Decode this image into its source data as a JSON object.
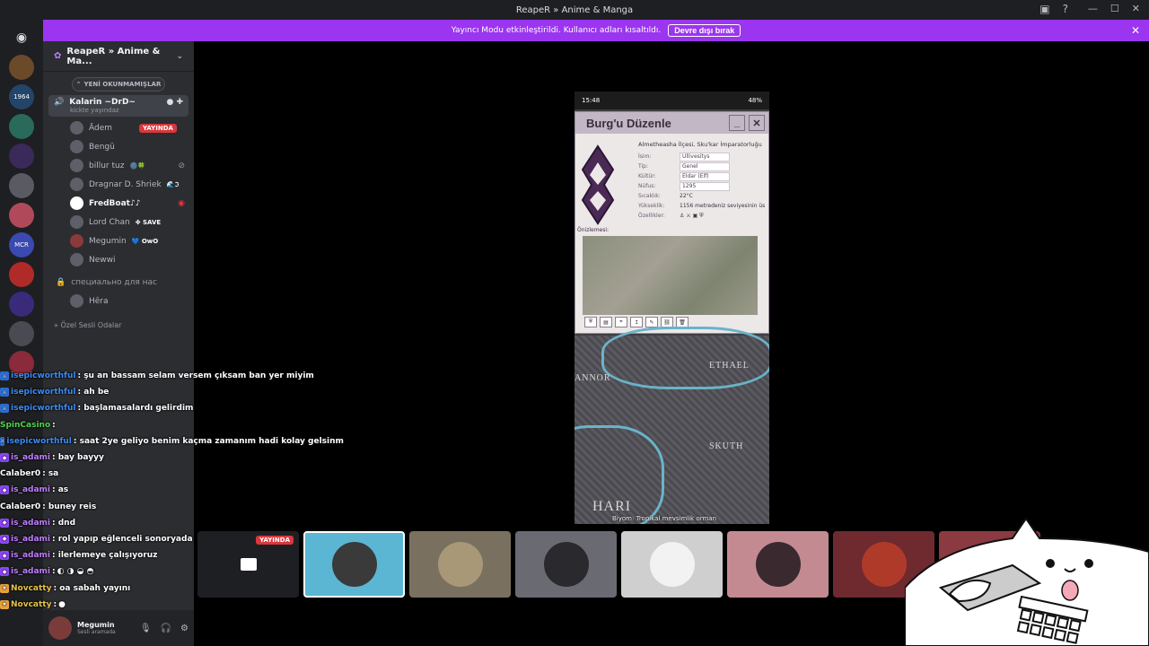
{
  "window": {
    "title": "ReapeR » Anime & Manga"
  },
  "banner": {
    "message": "Yayıncı Modu etkinleştirildi. Kullanıcı adları kısaltıldı.",
    "button": "Devre dışı bırak"
  },
  "rail": {
    "items": [
      "",
      "1964",
      "",
      "",
      "",
      "",
      "MCR",
      "",
      "",
      "",
      ""
    ]
  },
  "server": {
    "name": "ReapeR » Anime & Ma...",
    "new_unreads": "YENİ OKUNMAMIŞLAR"
  },
  "voice_channel": {
    "name": "Kalarin ~DrD~",
    "sub": "kickte yayındaz"
  },
  "members": [
    {
      "name": "Ädem",
      "live": "YAYINDA"
    },
    {
      "name": "Bengü"
    },
    {
      "name": "billur tuz",
      "tag": "🌚🍀"
    },
    {
      "name": "Dragnar D. Shriek",
      "tag": "🌊ℑ"
    },
    {
      "name": "FredBoat♪♪"
    },
    {
      "name": "Lord Chan",
      "tag": "✤ SAVE"
    },
    {
      "name": "Megumin",
      "tag": "💙 OwO"
    },
    {
      "name": "Newwi"
    }
  ],
  "private_channel": {
    "name": "специально для нас",
    "member": "Hêra"
  },
  "category": {
    "label": "» Özel Sesli Odalar"
  },
  "user_panel": {
    "name": "Megumin",
    "status": "Sesli aramada"
  },
  "phone": {
    "time": "15:48",
    "battery": "48%",
    "dialog_title": "Burg'u Düzenle",
    "burg_header": "Almetheasha İlçesi, Sku'kar İmparatorluğu",
    "fields": [
      {
        "key": "İsim:",
        "value": "Ullivesitys"
      },
      {
        "key": "Tip:",
        "value": "Genel"
      },
      {
        "key": "Kültür:",
        "value": "Eldar (Elf)"
      },
      {
        "key": "Nüfus:",
        "value": "1295"
      },
      {
        "key": "Sıcaklık:",
        "value": "22°C"
      },
      {
        "key": "Yükseklik:",
        "value": "1156 metredeniz seviyesinin üs"
      },
      {
        "key": "Özellikler:",
        "value": ""
      }
    ],
    "preview_label": "Önizlemesi:",
    "map_labels": [
      "ANNOR",
      "ETHAEL",
      "SKUTH",
      "HARI"
    ],
    "map_caption": "Biyom: Tropikal mevsimlik orman"
  },
  "participants": [
    {
      "live": "YAYINDA"
    },
    {},
    {},
    {},
    {},
    {},
    {},
    {}
  ],
  "chat": [
    {
      "user": "isepicworthful",
      "text": ": şu an bassam selam versem çıksam ban yer miyim",
      "color": "blue",
      "badge": "blue"
    },
    {
      "user": "isepicworthful",
      "text": ": ah be",
      "color": "blue",
      "badge": "blue"
    },
    {
      "user": "isepicworthful",
      "text": ": başlamasalardı gelirdim",
      "color": "blue",
      "badge": "blue"
    },
    {
      "user": "SpinCasino",
      "text": ":",
      "color": "green",
      "badge": ""
    },
    {
      "user": "isepicworthful",
      "text": ": saat 2ye geliyo benim kaçma zamanım hadi kolay gelsinm",
      "color": "blue",
      "badge": "blue"
    },
    {
      "user": "is_adami",
      "text": ": bay bayyy",
      "color": "purple",
      "badge": "purple"
    },
    {
      "user": "Calaber0",
      "text": ": sa",
      "color": "plain",
      "badge": ""
    },
    {
      "user": "is_adami",
      "text": ": as",
      "color": "purple",
      "badge": "purple"
    },
    {
      "user": "Calaber0",
      "text": ": buney reis",
      "color": "plain",
      "badge": ""
    },
    {
      "user": "is_adami",
      "text": ": dnd",
      "color": "purple",
      "badge": "purple"
    },
    {
      "user": "is_adami",
      "text": ": rol yapıp eğlenceli sonoryada",
      "color": "purple",
      "badge": "purple"
    },
    {
      "user": "is_adami",
      "text": ": ilerlemeye çalışıyoruz",
      "color": "purple",
      "badge": "purple"
    },
    {
      "user": "is_adami",
      "text": ":",
      "color": "purple",
      "badge": "purple"
    },
    {
      "user": "Novcatty",
      "text": ": oa sabah yayını",
      "color": "gold",
      "badge": "gold"
    },
    {
      "user": "Novcatty",
      "text": ":",
      "color": "gold",
      "badge": "gold"
    }
  ]
}
